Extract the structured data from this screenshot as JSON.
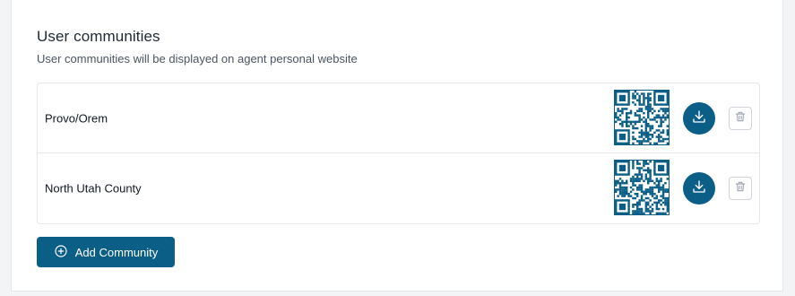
{
  "section": {
    "title": "User communities",
    "subtitle": "User communities will be displayed on agent personal website"
  },
  "communities": [
    {
      "name": "Provo/Orem"
    },
    {
      "name": "North Utah County"
    }
  ],
  "actions": {
    "add_label": "Add Community"
  },
  "icons": {
    "download": "download-icon",
    "delete": "trash-icon",
    "add": "plus-circle-icon",
    "qr": "qr-code"
  },
  "colors": {
    "accent": "#0b5e86",
    "text": "#1f2937",
    "muted": "#4b5563",
    "border": "#e5e7eb"
  }
}
